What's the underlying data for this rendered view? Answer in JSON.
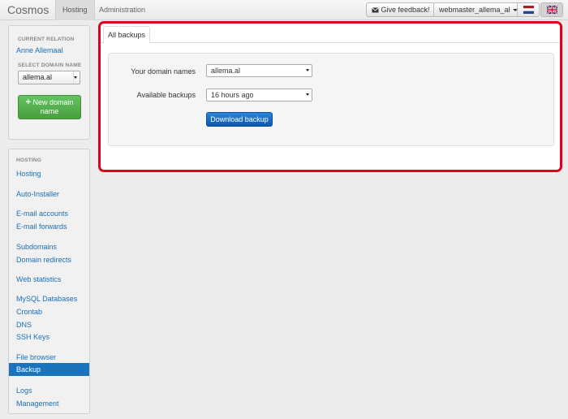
{
  "navbar": {
    "brand": "Cosmos",
    "tabs": [
      {
        "label": "Hosting",
        "active": true
      },
      {
        "label": "Administration",
        "active": false
      }
    ],
    "feedback_label": "Give feedback!",
    "feedback_icon": "envelope-icon",
    "user_menu_label": "webmaster_allema_al",
    "languages": [
      {
        "name": "netherlands-flag-icon",
        "active": false
      },
      {
        "name": "uk-flag-icon",
        "active": true
      }
    ]
  },
  "relation_panel": {
    "current_relation_heading": "CURRENT RELATION",
    "current_relation_name": "Anne Allemaal",
    "select_domain_heading": "SELECT DOMAIN NAME",
    "selected_domain": "allema.al",
    "new_domain_button": "New domain name",
    "new_domain_icon": "plus-icon"
  },
  "hosting_nav": {
    "heading": "HOSTING",
    "items": {
      "hosting": "Hosting",
      "auto_installer": "Auto-Installer",
      "email_accounts": "E-mail accounts",
      "email_forwards": "E-mail forwards",
      "subdomains": "Subdomains",
      "domain_redirects": "Domain redirects",
      "web_statistics": "Web statistics",
      "mysql_databases": "MySQL Databases",
      "crontab": "Crontab",
      "dns": "DNS",
      "ssh_keys": "SSH Keys",
      "file_browser": "File browser",
      "backup": "Backup",
      "logs": "Logs",
      "management": "Management"
    },
    "active_item": "Backup"
  },
  "main": {
    "tab_label": "All backups",
    "form": {
      "domain_label": "Your domain names",
      "domain_value": "allema.al",
      "backups_label": "Available backups",
      "backups_value": "16 hours ago",
      "download_button": "Download backup"
    }
  },
  "colors": {
    "accent_blue": "#1a73bd",
    "link_blue": "#1a6fb5",
    "success_green": "#5cb85c",
    "highlight_red": "#e2001a"
  }
}
